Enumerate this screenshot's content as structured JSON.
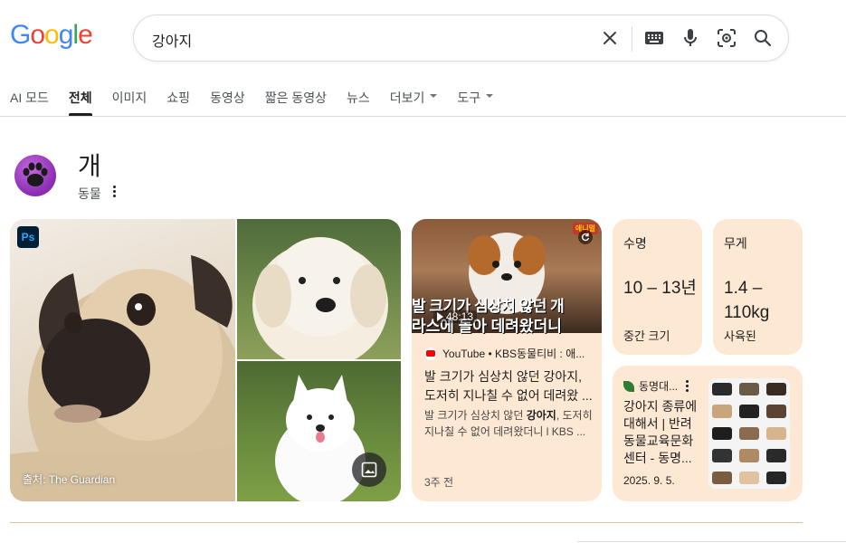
{
  "logo": {
    "text": "Google",
    "letters": [
      {
        "ch": "G",
        "color": "#4285F4"
      },
      {
        "ch": "o",
        "color": "#EA4335"
      },
      {
        "ch": "o",
        "color": "#FBBC05"
      },
      {
        "ch": "g",
        "color": "#4285F4"
      },
      {
        "ch": "l",
        "color": "#34A853"
      },
      {
        "ch": "e",
        "color": "#EA4335"
      }
    ]
  },
  "search": {
    "query": "강아지",
    "icons": [
      "clear-icon",
      "keyboard-icon",
      "mic-icon",
      "lens-icon",
      "search-icon"
    ]
  },
  "tabs": [
    {
      "label": "AI 모드",
      "active": false
    },
    {
      "label": "전체",
      "active": true
    },
    {
      "label": "이미지",
      "active": false
    },
    {
      "label": "쇼핑",
      "active": false
    },
    {
      "label": "동영상",
      "active": false
    },
    {
      "label": "짧은 동영상",
      "active": false
    },
    {
      "label": "뉴스",
      "active": false
    },
    {
      "label": "더보기",
      "active": false,
      "dropdown": true
    },
    {
      "label": "도구",
      "active": false,
      "dropdown": true
    }
  ],
  "entity": {
    "title": "개",
    "subtitle": "동물"
  },
  "images": {
    "ps_badge": "Ps",
    "source_caption": "출처: The Guardian"
  },
  "video": {
    "overlay_line1": "발 크기가 심상치 않던 개",
    "overlay_line2": "라스에 돌아 데려왔더니",
    "duration": "48:13",
    "badge": "애니멀",
    "source": "YouTube • KBS동물티비 : 애...",
    "title": "발 크기가 심상치 않던 강아지, 도저히 지나칠 수 없어 데려왔 ...",
    "snippet_pre": "발 크기가 심상치 않던 ",
    "snippet_bold": "강아지",
    "snippet_post": ", 도저히 지나칠 수 없어 데려왔더니 l KBS ...",
    "age": "3주 전"
  },
  "facts": [
    {
      "label": "수명",
      "value": "10 – 13년",
      "note": "중간 크기"
    },
    {
      "label": "무게",
      "value": "1.4 – 110kg",
      "note": "사육된"
    }
  ],
  "article": {
    "source": "동명대...",
    "title": "강아지 종류에 대해서 | 반려동물교육문화 센터 - 동명...",
    "date": "2025. 9. 5."
  },
  "colors": {
    "card_bg": "#fde8d3",
    "accent_purple": "#8a2bb0",
    "text_primary": "#1f1f1f",
    "text_secondary": "#4d5156"
  }
}
